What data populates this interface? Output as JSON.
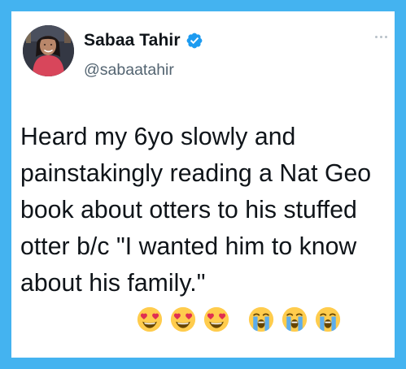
{
  "tweet": {
    "author": {
      "display_name": "Sabaa Tahir",
      "handle": "@sabaatahir",
      "verified": true,
      "avatar_icon": "author-avatar"
    },
    "text": "Heard my 6yo slowly and painstakingly reading a Nat Geo book about otters to his stuffed otter b/c \"I wanted him to know about his family.\"",
    "emojis": [
      "heart-eyes",
      "heart-eyes",
      "heart-eyes",
      "loudly-crying",
      "loudly-crying",
      "loudly-crying"
    ],
    "more_icon": "more-options-icon"
  },
  "colors": {
    "frame_background": "#44b3f0",
    "card_background": "#ffffff",
    "text_primary": "#0f1419",
    "text_secondary": "#536471",
    "verified_badge": "#1d9bf0"
  }
}
